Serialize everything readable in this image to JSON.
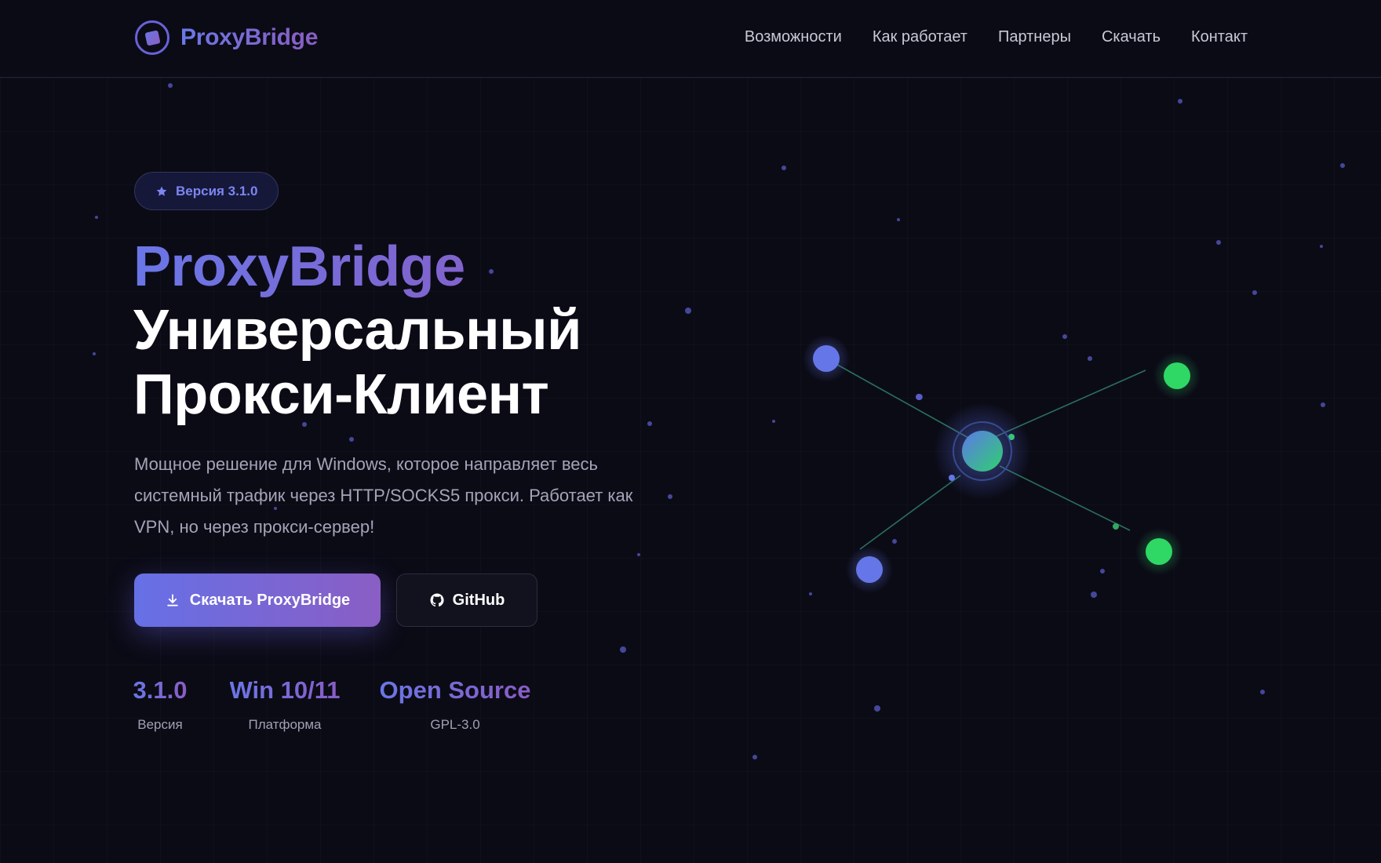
{
  "nav": {
    "brand": "ProxyBridge",
    "links": [
      "Возможности",
      "Как работает",
      "Партнеры",
      "Скачать",
      "Контакт"
    ]
  },
  "hero": {
    "badge": "Версия 3.1.0",
    "title_brand": "ProxyBridge",
    "title_line1": "Универсальный",
    "title_line2": "Прокси-Клиент",
    "description": "Мощное решение для Windows, которое направляет весь системный трафик через HTTP/SOCKS5 прокси. Работает как VPN, но через прокси-сервер!",
    "download_label": "Скачать ProxyBridge",
    "github_label": "GitHub"
  },
  "stats": [
    {
      "value": "3.1.0",
      "label": "Версия"
    },
    {
      "value": "Win 10/11",
      "label": "Платформа"
    },
    {
      "value": "Open Source",
      "label": "GPL-3.0"
    }
  ],
  "icons": {
    "logo": "logo-icon",
    "badge": "star-icon",
    "download": "download-icon",
    "github": "github-icon"
  },
  "colors": {
    "background": "#0b0b16",
    "accent_start": "#6a76e6",
    "accent_end": "#8a5cc4",
    "node_blue": "#6576e8",
    "node_green": "#2fd865"
  }
}
